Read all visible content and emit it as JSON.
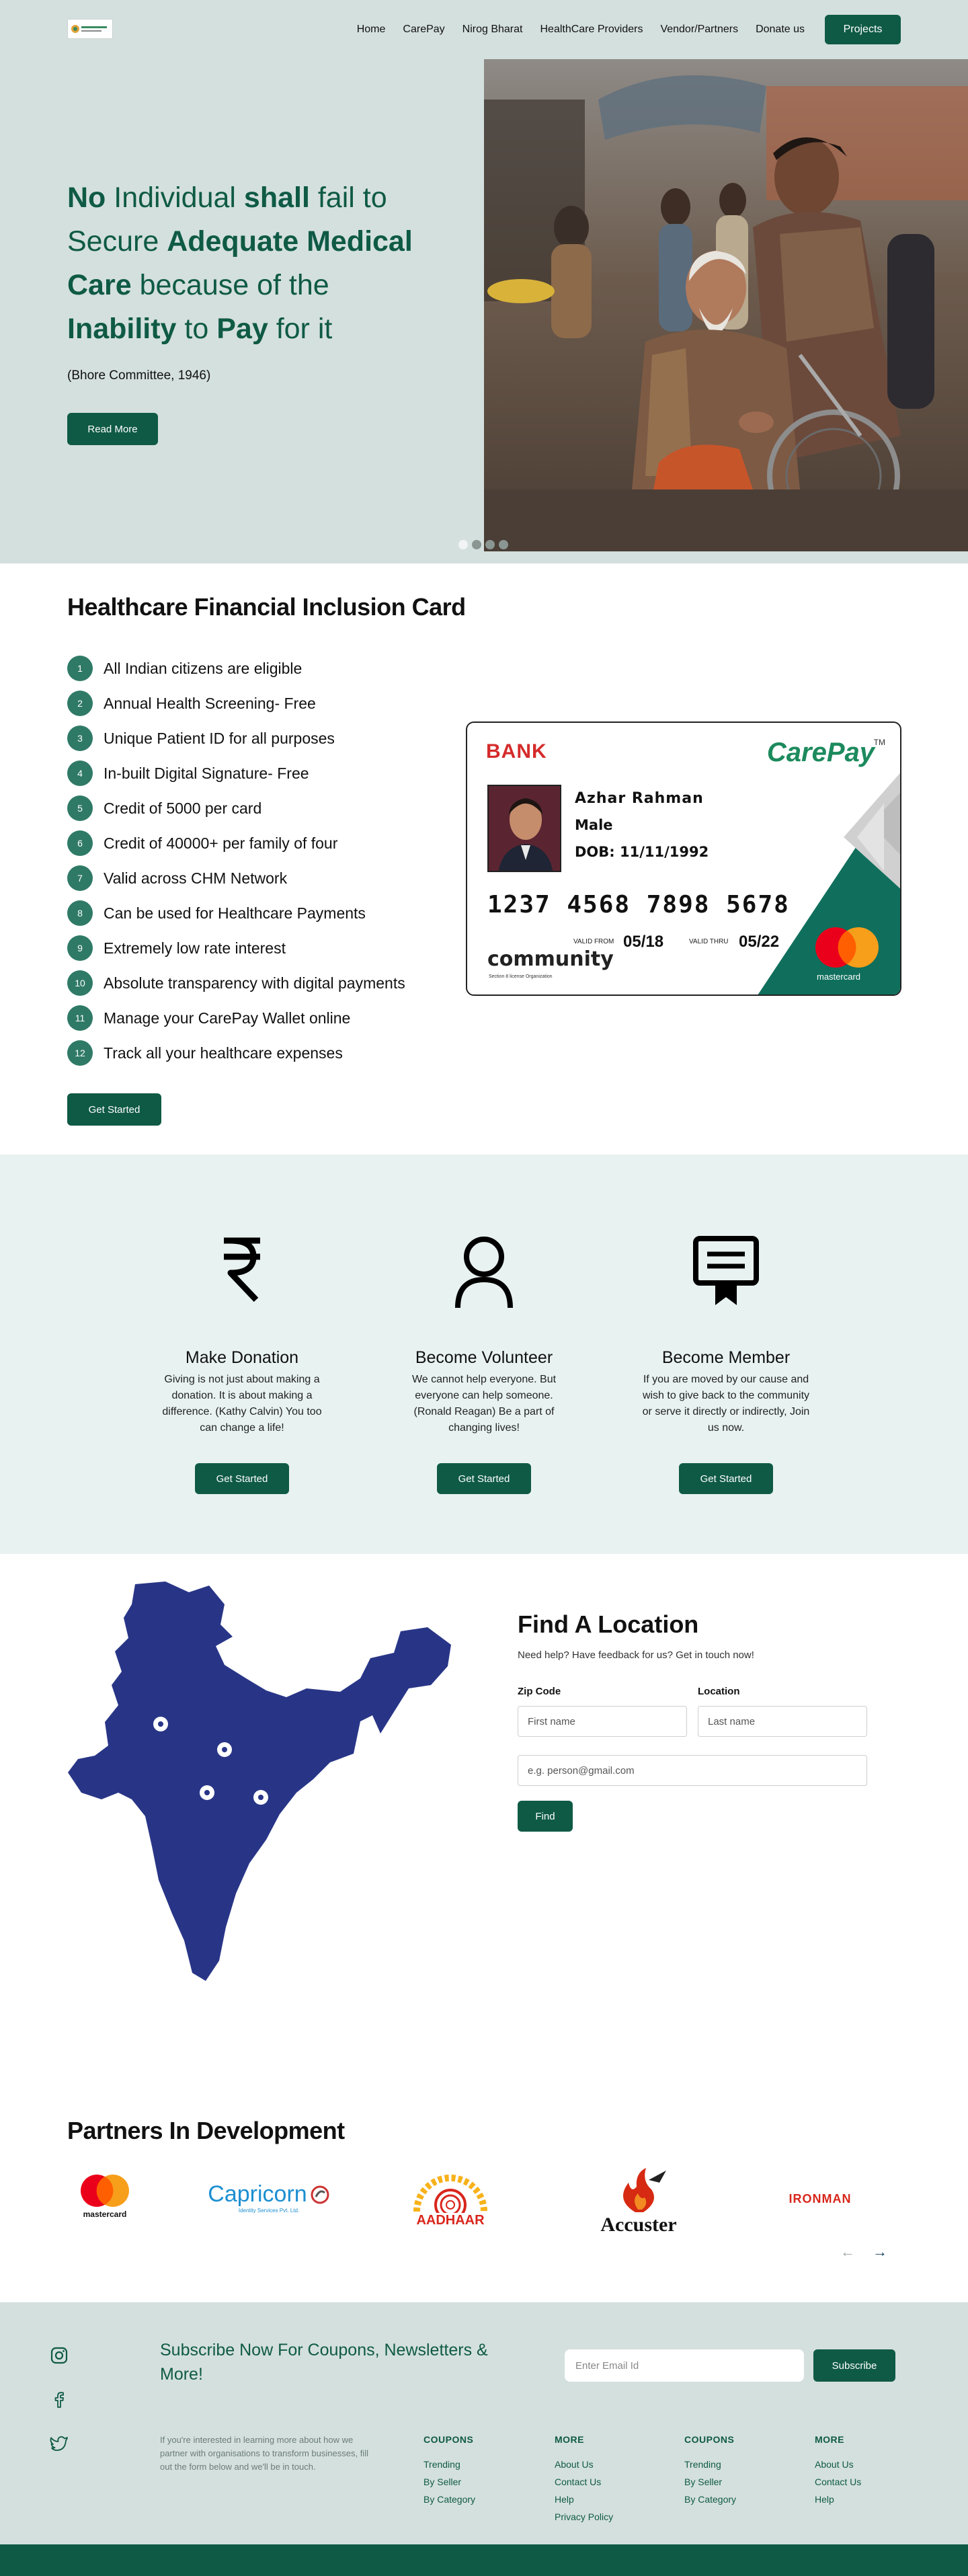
{
  "header": {
    "nav": [
      "Home",
      "CarePay",
      "Nirog Bharat",
      "HealthCare Providers",
      "Vendor/Partners",
      "Donate us"
    ],
    "projects_button": "Projects"
  },
  "hero": {
    "line1_bold": "No",
    "line1_rest": " Individual ",
    "line1_bold2": "shall",
    "line1_rest2": " fail to",
    "line2_rest": "Secure ",
    "line2_bold": "Adequate Medical",
    "line3_bold": "Care",
    "line3_rest": " because of the",
    "line4_bold": "Inability",
    "line4_rest": " to ",
    "line4_bold2": "Pay",
    "line4_rest2": " for it",
    "quote": "(Bhore Committee, 1946)",
    "read_more": "Read More",
    "slides": 4,
    "active_slide": 1
  },
  "card_section": {
    "title": "Healthcare Financial Inclusion Card",
    "features": [
      {
        "n": "1",
        "text": "All Indian citizens are eligible"
      },
      {
        "n": "2",
        "text": "Annual Health Screening- Free"
      },
      {
        "n": "3",
        "text": "Unique Patient ID for all purposes"
      },
      {
        "n": "4",
        "text": "In-built Digital Signature- Free"
      },
      {
        "n": "5",
        "text": "Credit of 5000 per card"
      },
      {
        "n": "6",
        "text": "Credit of 40000+ per family of four"
      },
      {
        "n": "7",
        "text": "Valid across CHM Network"
      },
      {
        "n": "8",
        "text": "Can be used for Healthcare Payments"
      },
      {
        "n": "9",
        "text": "Extremely low rate interest"
      },
      {
        "n": "10",
        "text": "Absolute transparency with digital payments"
      },
      {
        "n": "11",
        "text": "Manage your CarePay Wallet online"
      },
      {
        "n": "12",
        "text": "Track all your healthcare expenses"
      }
    ],
    "get_started": "Get Started",
    "card": {
      "bank": "BANK",
      "brand": "CarePay",
      "tm": "TM",
      "name": "Azhar Rahman",
      "sex": "Male",
      "dob": "DOB: 11/11/1992",
      "number": "1237 4568 7898 5678",
      "valid_from_label": "VALID FROM",
      "valid_from": "05/18",
      "valid_thru_label": "VALID THRU",
      "valid_thru": "05/22",
      "community": "community",
      "community_sub": "Section 8 license Organization",
      "network": "mastercard"
    }
  },
  "actions": [
    {
      "icon": "rupee-icon",
      "title": "Make Donation",
      "text": "Giving is not just about making a donation. It is about making a difference. (Kathy Calvin) You too can change a life!",
      "button": "Get Started"
    },
    {
      "icon": "user-icon",
      "title": "Become Volunteer",
      "text": "We cannot help everyone. But everyone can help someone. (Ronald Reagan) Be a part of changing lives!",
      "button": "Get Started"
    },
    {
      "icon": "certificate-icon",
      "title": "Become Member",
      "text": "If you are moved by our cause and wish to give back to the community or serve it directly or indirectly, Join us now.",
      "button": "Get Started"
    }
  ],
  "find_location": {
    "title": "Find A Location",
    "subtitle": "Need help? Have feedback for us? Get in touch now!",
    "zip_label": "Zip Code",
    "location_label": "Location",
    "zip_placeholder": "First name",
    "location_placeholder": "Last name",
    "email_placeholder": "e.g. person@gmail.com",
    "find_button": "Find"
  },
  "partners": {
    "title": "Partners In Development",
    "logos": [
      "mastercard",
      "Capricorn",
      "Identity Services Pvt. Ltd.",
      "AADHAAR",
      "Accuster",
      "IRONMAN"
    ],
    "prev": "←",
    "next": "→"
  },
  "footer": {
    "subscribe_title": "Subscribe Now For Coupons, Newsletters & More!",
    "email_placeholder": "Enter Email Id",
    "subscribe_button": "Subscribe",
    "description": "If you're interested in learning more about how we partner with organisations to transform businesses, fill out the form below and we'll be in touch.",
    "columns": [
      {
        "heading": "COUPONS",
        "links": [
          "Trending",
          "By Seller",
          "By Category"
        ]
      },
      {
        "heading": "MORE",
        "links": [
          "About Us",
          "Contact Us",
          "Help",
          "Privacy Policy"
        ]
      },
      {
        "heading": "COUPONS",
        "links": [
          "Trending",
          "By Seller",
          "By Category"
        ]
      },
      {
        "heading": "MORE",
        "links": [
          "About Us",
          "Contact Us",
          "Help"
        ]
      }
    ],
    "social_icons": [
      "instagram-icon",
      "facebook-icon",
      "twitter-icon"
    ]
  },
  "colors": {
    "primary": "#0f5a45",
    "hero_bg": "#d4e0de",
    "band_bg": "#e8f2f1",
    "map": "#283587"
  }
}
